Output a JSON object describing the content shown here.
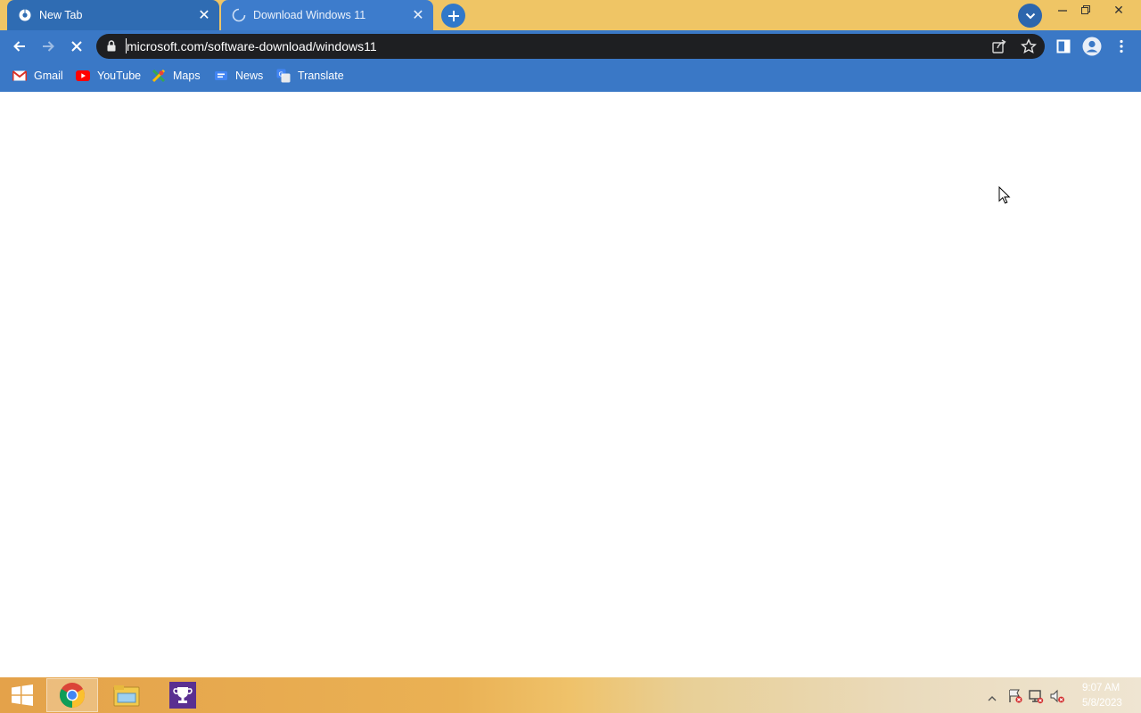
{
  "tabs": [
    {
      "title": "New Tab"
    },
    {
      "title": "Download Windows 11"
    }
  ],
  "omnibox": {
    "url": "microsoft.com/software-download/windows11"
  },
  "bookmarks": [
    {
      "label": "Gmail",
      "icon": "gmail-icon"
    },
    {
      "label": "YouTube",
      "icon": "youtube-icon"
    },
    {
      "label": "Maps",
      "icon": "maps-icon"
    },
    {
      "label": "News",
      "icon": "news-icon"
    },
    {
      "label": "Translate",
      "icon": "translate-icon"
    }
  ],
  "taskbar": {
    "apps": [
      "chrome",
      "file-explorer",
      "trophy-app"
    ],
    "time": "9:07 AM",
    "date": "5/8/2023"
  },
  "colors": {
    "tabstrip": "#efc565",
    "active_tab": "#2f6cb3",
    "toolbar": "#3a78c6",
    "omnibox": "#1e1f22"
  }
}
